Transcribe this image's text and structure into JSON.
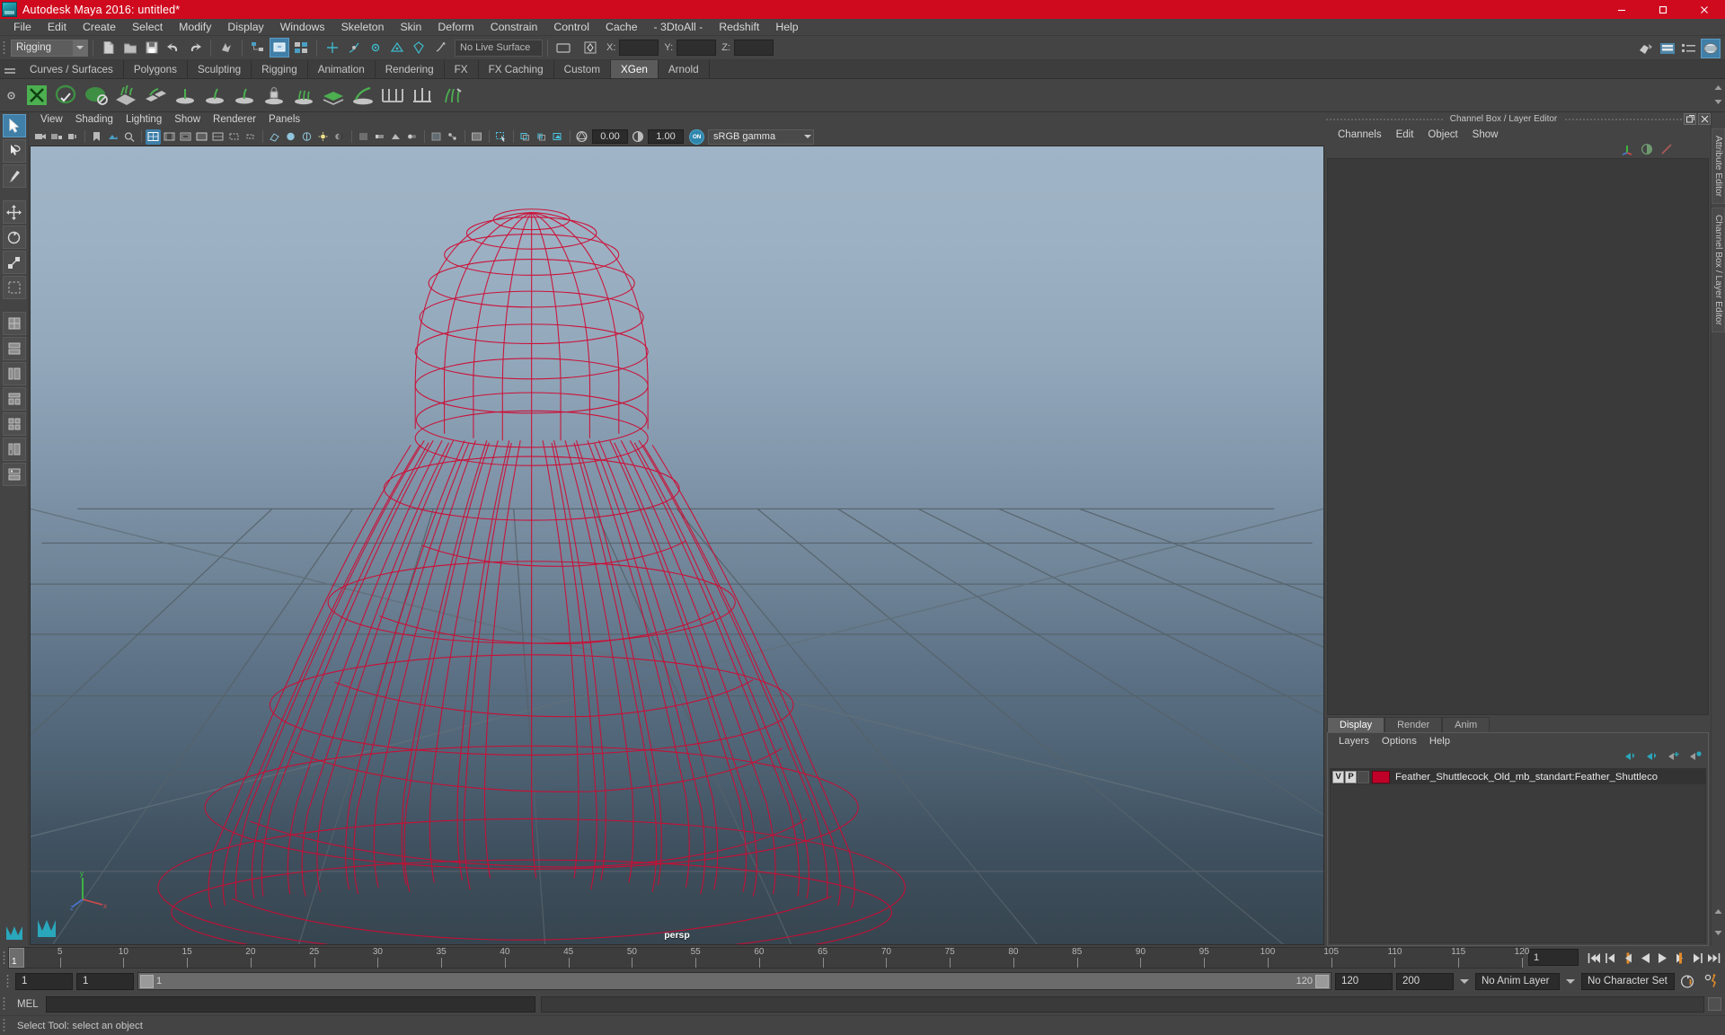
{
  "window": {
    "title": "Autodesk Maya 2016: untitled*",
    "logo_icon": "maya-logo-icon",
    "buttons": [
      {
        "name": "minimize-button",
        "label": "—",
        "icon": "minimize-icon"
      },
      {
        "name": "maximize-button",
        "label": "▢",
        "icon": "maximize-icon"
      },
      {
        "name": "close-button",
        "label": "✕",
        "icon": "close-icon"
      }
    ],
    "titlebar_color": "#cf0a1e"
  },
  "menubar": {
    "items": [
      "File",
      "Edit",
      "Create",
      "Select",
      "Modify",
      "Display",
      "Windows",
      "Skeleton",
      "Skin",
      "Deform",
      "Constrain",
      "Control",
      "Cache",
      "- 3DtoAll -",
      "Redshift",
      "Help"
    ]
  },
  "statusline": {
    "menu_set": "Rigging",
    "live_surface": "No Live Surface",
    "coords": {
      "x_label": "X:",
      "y_label": "Y:",
      "z_label": "Z:",
      "x_value": "",
      "y_value": "",
      "z_value": ""
    },
    "icons": [
      "new-scene-icon",
      "open-scene-icon",
      "save-scene-icon",
      "undo-icon",
      "redo-icon",
      "select-by-hierarchy-icon",
      "select-by-object-icon",
      "select-by-component-icon",
      "snap-to-grid-icon",
      "snap-to-curve-icon",
      "snap-to-point-icon",
      "snap-to-projected-center-icon",
      "snap-to-view-plane-icon",
      "make-live-icon",
      "construction-history-icon"
    ],
    "right_icons": [
      "show-hide-modeling-toolkit-icon",
      "show-hide-attribute-editor-icon",
      "show-hide-tool-settings-icon",
      "show-hide-channel-box-icon"
    ]
  },
  "shelf": {
    "tabs": [
      "Curves / Surfaces",
      "Polygons",
      "Sculpting",
      "Rigging",
      "Animation",
      "Rendering",
      "FX",
      "FX Caching",
      "Custom",
      "XGen",
      "Arnold"
    ],
    "active_tab": "XGen",
    "icons": [
      "xgen-window-icon",
      "xgen-create-description-icon",
      "xgen-create-palette-icon",
      "xgen-guides-icon",
      "xgen-patches-icon",
      "xgen-add-guide-icon",
      "xgen-sculpt-guide-icon",
      "xgen-move-guide-icon",
      "xgen-lock-guide-icon",
      "xgen-density-brush-icon",
      "xgen-layer-icon",
      "xgen-groom-icon",
      "xgen-region-icon",
      "xgen-noise-icon",
      "xgen-clump-icon"
    ]
  },
  "toolbox": {
    "items": [
      {
        "name": "select-tool",
        "icon": "arrow-select-icon",
        "active": true
      },
      {
        "name": "lasso-select-tool",
        "icon": "lasso-icon",
        "active": false
      },
      {
        "name": "paint-select-tool",
        "icon": "paint-brush-icon",
        "active": false
      },
      {
        "name": "move-tool",
        "icon": "move-arrows-icon",
        "active": false
      },
      {
        "name": "rotate-tool",
        "icon": "rotate-circle-icon",
        "active": false
      },
      {
        "name": "scale-tool",
        "icon": "scale-box-icon",
        "active": false
      },
      {
        "name": "last-tool-used",
        "icon": "last-tool-icon",
        "active": false
      },
      {
        "name": "single-pane-layout",
        "icon": "single-pane-icon",
        "active": false
      },
      {
        "name": "two-pane-side-layout",
        "icon": "two-pane-side-icon",
        "active": false
      },
      {
        "name": "two-pane-stacked-layout",
        "icon": "two-pane-stacked-icon",
        "active": false
      },
      {
        "name": "three-pane-layout",
        "icon": "three-pane-icon",
        "active": false
      },
      {
        "name": "four-pane-layout",
        "icon": "four-pane-icon",
        "active": false
      },
      {
        "name": "persp-outliner-layout",
        "icon": "persp-outliner-icon",
        "active": false
      },
      {
        "name": "hypershade-persp-layout",
        "icon": "hypershade-persp-icon",
        "active": false
      }
    ],
    "bottom_label": "-"
  },
  "viewport": {
    "menus": [
      "View",
      "Shading",
      "Lighting",
      "Show",
      "Renderer",
      "Panels"
    ],
    "camera_label": "persp",
    "exposure": "0.00",
    "gamma": "1.00",
    "color_management": "sRGB gamma",
    "color_management_toggle": "ON",
    "toolbar_icons": [
      "select-camera-icon",
      "lock-camera-icon",
      "camera-attributes-icon",
      "bookmarks-icon",
      "image-plane-icon",
      "two-d-pan-zoom-icon",
      "grid-toggle-icon",
      "film-gate-icon",
      "resolution-gate-icon",
      "gate-mask-icon",
      "field-chart-icon",
      "safe-action-icon",
      "safe-title-icon",
      "wireframe-shading-icon",
      "smooth-shading-icon",
      "smooth-shade-all-icon",
      "use-all-lights-icon",
      "shadows-icon",
      "screen-space-ao-icon",
      "motion-blur-icon",
      "multisample-aa-icon",
      "depth-of-field-icon",
      "xray-icon",
      "xray-joints-icon",
      "isolate-select-icon",
      "no-texture-icon",
      "hardware-texturing-icon",
      "high-quality-render-icon"
    ],
    "axis_gizmo": {
      "x": "x",
      "y": "y",
      "z": "z"
    }
  },
  "channel_box": {
    "dock_title": "Channel Box / Layer Editor",
    "menus": [
      "Channels",
      "Edit",
      "Object",
      "Show"
    ],
    "quick_icons": [
      "transform-channels-icon",
      "shape-channels-icon",
      "output-channels-icon"
    ],
    "float_icon": "undock-icon",
    "close_icon": "close-icon"
  },
  "layer_editor": {
    "tabs": [
      "Display",
      "Render",
      "Anim"
    ],
    "active_tab": "Display",
    "menus": [
      "Layers",
      "Options",
      "Help"
    ],
    "tool_icons": [
      "move-layer-up-icon",
      "move-layer-down-icon",
      "new-layer-icon",
      "new-layer-from-selected-icon"
    ],
    "rows": [
      {
        "visibility": "V",
        "playback": "P",
        "color": "#c00028",
        "name": "Feather_Shuttlecock_Old_mb_standart:Feather_Shuttleco"
      }
    ]
  },
  "right_strip": {
    "tabs": [
      "Attribute Editor",
      "Channel Box / Layer Editor"
    ]
  },
  "timeline": {
    "current_frame": "1",
    "frame_field": "1",
    "ticks": [
      5,
      10,
      15,
      20,
      25,
      30,
      35,
      40,
      45,
      50,
      55,
      60,
      65,
      70,
      75,
      80,
      85,
      90,
      95,
      100,
      105,
      110,
      115,
      120
    ],
    "range_start": 1,
    "range_end": 120,
    "playback_buttons": [
      "go-to-start-icon",
      "step-back-keyframe-icon",
      "step-back-frame-icon",
      "play-backwards-icon",
      "play-forwards-icon",
      "step-forward-frame-icon",
      "step-forward-keyframe-icon",
      "go-to-end-icon"
    ]
  },
  "range_slider": {
    "anim_start": "1",
    "playback_start": "1",
    "bar_start_label": "1",
    "bar_end_label": "120",
    "playback_end": "120",
    "anim_end": "200",
    "anim_layer": "No Anim Layer",
    "character_set": "No Character Set",
    "auto_key_icon": "auto-keyframe-icon",
    "anim_prefs_icon": "animation-preferences-icon"
  },
  "command_line": {
    "label": "MEL",
    "input_value": "",
    "output_value": "",
    "script_editor_icon": "script-editor-icon"
  },
  "help_line": {
    "text": "Select Tool: select an object"
  }
}
